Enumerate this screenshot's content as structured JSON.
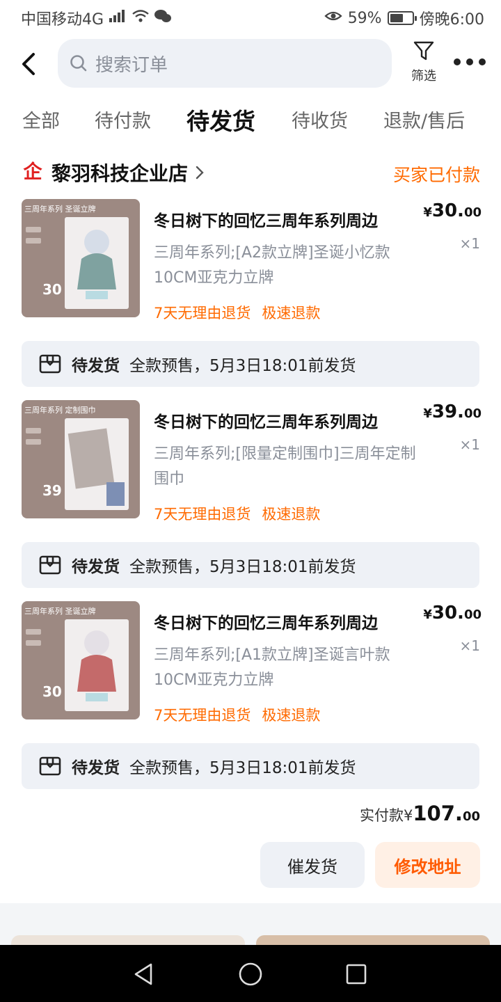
{
  "status_bar": {
    "carrier": "中国移动4G",
    "network_tag": "4G",
    "battery": "59%",
    "battery_level": 0.59,
    "time": "傍晚6:00"
  },
  "header": {
    "search_placeholder": "搜索订单",
    "filter_label": "筛选"
  },
  "tabs": [
    {
      "label": "全部",
      "active": false
    },
    {
      "label": "待付款",
      "active": false
    },
    {
      "label": "待发货",
      "active": true
    },
    {
      "label": "待收货",
      "active": false
    },
    {
      "label": "退款/售后",
      "active": false
    }
  ],
  "order": {
    "shop_badge": "企",
    "shop_name": "黎羽科技企业店",
    "status": "买家已付款",
    "items": [
      {
        "thumb_tag": "三周年系列 圣诞立牌",
        "thumb_price": "30",
        "title": "冬日树下的回忆三周年系列周边",
        "spec": "三周年系列;[A2款立牌]圣诞小忆款10CM亚克力立牌",
        "price_symbol": "¥",
        "price_int": "30.",
        "price_dec": "00",
        "qty": "×1",
        "services": [
          "7天无理由退货",
          "极速退款"
        ],
        "ship_status": "待发货",
        "ship_note": "全款预售，5月3日18:01前发货"
      },
      {
        "thumb_tag": "三周年系列 定制围巾",
        "thumb_price": "39",
        "title": "冬日树下的回忆三周年系列周边",
        "spec": "三周年系列;[限量定制围巾]三周年定制围巾",
        "price_symbol": "¥",
        "price_int": "39.",
        "price_dec": "00",
        "qty": "×1",
        "services": [
          "7天无理由退货",
          "极速退款"
        ],
        "ship_status": "待发货",
        "ship_note": "全款预售，5月3日18:01前发货"
      },
      {
        "thumb_tag": "三周年系列 圣诞立牌",
        "thumb_price": "30",
        "title": "冬日树下的回忆三周年系列周边",
        "spec": "三周年系列;[A1款立牌]圣诞言叶款10CM亚克力立牌",
        "price_symbol": "¥",
        "price_int": "30.",
        "price_dec": "00",
        "qty": "×1",
        "services": [
          "7天无理由退货",
          "极速退款"
        ],
        "ship_status": "待发货",
        "ship_note": "全款预售，5月3日18:01前发货"
      }
    ],
    "total_label": "实付款",
    "total_symbol": "¥",
    "total_int": "107.",
    "total_dec": "00",
    "remind_button": "催发货",
    "address_button": "修改地址"
  },
  "colors": {
    "accent": "#ff6a00",
    "shop_badge": "#e02020",
    "chip_bg": "#eef1f6",
    "page_bg": "#f3f5f7"
  }
}
